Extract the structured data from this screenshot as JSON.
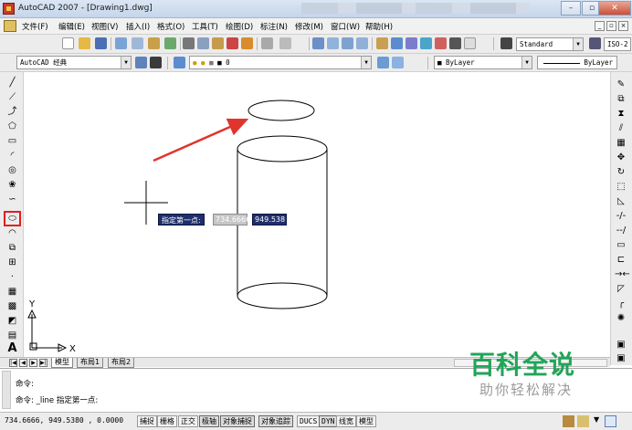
{
  "window": {
    "title": "AutoCAD 2007 - [Drawing1.dwg]",
    "min_label": "–",
    "max_label": "▫",
    "close_label": "✕"
  },
  "menu": {
    "items": [
      "文件(F)",
      "编辑(E)",
      "视图(V)",
      "插入(I)",
      "格式(O)",
      "工具(T)",
      "绘图(D)",
      "标注(N)",
      "修改(M)",
      "窗口(W)",
      "帮助(H)"
    ],
    "mdi_min": "_",
    "mdi_restore": "▫",
    "mdi_close": "×"
  },
  "toolbar": {
    "text_style": "Standard",
    "dim_style_partial": "ISO-2"
  },
  "toolbar2": {
    "workspace": "AutoCAD 经典",
    "layer": "0",
    "color": "ByLayer",
    "linetype": "ByLayer"
  },
  "dynamic_input": {
    "prompt": "指定第一点:",
    "x_value": "734.6666",
    "y_value": "949.538"
  },
  "ucs": {
    "y_label": "Y",
    "x_label": "X"
  },
  "layout_tabs": [
    "模型",
    "布局1",
    "布局2"
  ],
  "command": {
    "line1": "命令:",
    "line2": "命令:  _line 指定第一点:"
  },
  "watermark": {
    "title": "百科全说",
    "subtitle": "助你轻松解决"
  },
  "status": {
    "coords": "734.6666,  949.5380 , 0.0000",
    "buttons": [
      "捕捉",
      "栅格",
      "正交",
      "极轴",
      "对象捕捉",
      "对象追踪",
      "DUCS",
      "DYN",
      "线宽",
      "模型"
    ]
  },
  "colors": {
    "highlight": "#e02020",
    "arrow": "#e0342c",
    "tooltip_bg": "#1f2f6b",
    "watermark_green": "#21a558"
  }
}
